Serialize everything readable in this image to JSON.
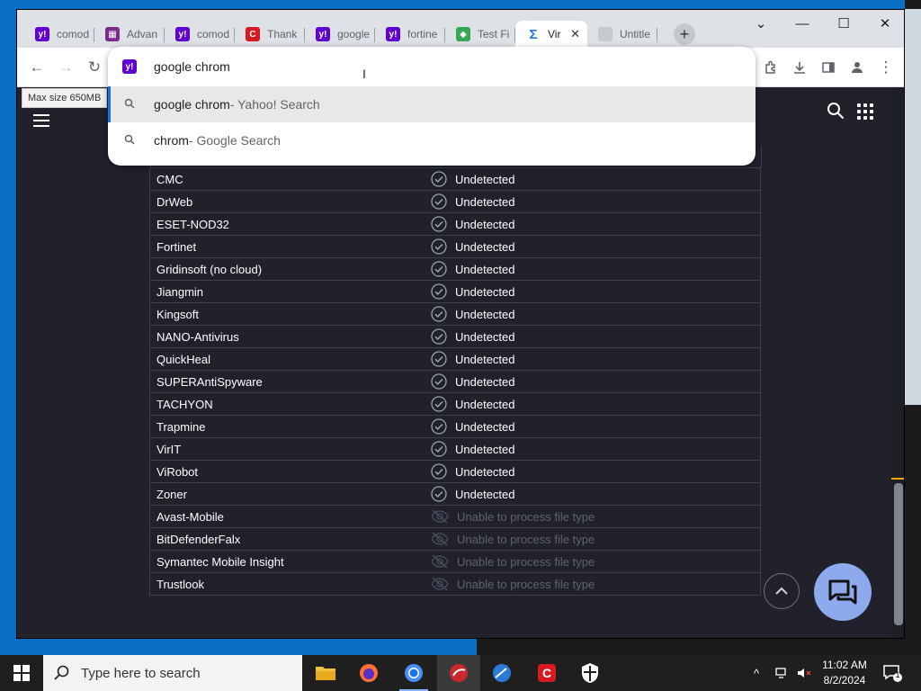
{
  "browser": {
    "tabs": [
      {
        "title": "comod",
        "favicon": "yahoo-icon",
        "color": "#6001d2",
        "glyph": "y!"
      },
      {
        "title": "Advan",
        "favicon": "grid-logo-icon",
        "color": "#7b2a8c",
        "glyph": "▦"
      },
      {
        "title": "comod",
        "favicon": "yahoo-icon",
        "color": "#6001d2",
        "glyph": "y!"
      },
      {
        "title": "Thank",
        "favicon": "comodo-c-icon",
        "color": "#d71920",
        "glyph": "C"
      },
      {
        "title": "google",
        "favicon": "yahoo-icon",
        "color": "#6001d2",
        "glyph": "y!"
      },
      {
        "title": "fortine",
        "favicon": "yahoo-icon",
        "color": "#6001d2",
        "glyph": "y!"
      },
      {
        "title": "Test Fi",
        "favicon": "shield-icon",
        "color": "#34a853",
        "glyph": "◆"
      },
      {
        "title": "Vir",
        "favicon": "virustotal-icon",
        "color": "#ffffff",
        "glyph": "Σ",
        "active": true
      },
      {
        "title": "Untitle",
        "favicon": "blank-page-icon",
        "color": "#9aa0a6",
        "glyph": ""
      }
    ],
    "omnibox": {
      "value": "google chrom",
      "suggestions": [
        {
          "main": "google chrom",
          "sub": " - Yahoo! Search",
          "selected": true
        },
        {
          "main": "chrom",
          "sub": " - Google Search",
          "selected": false
        }
      ]
    },
    "tooltip": "Max size 650MB"
  },
  "results": {
    "rows": [
      {
        "engine": "CMC",
        "status": "Undetected",
        "kind": "undetected"
      },
      {
        "engine": "DrWeb",
        "status": "Undetected",
        "kind": "undetected"
      },
      {
        "engine": "ESET-NOD32",
        "status": "Undetected",
        "kind": "undetected"
      },
      {
        "engine": "Fortinet",
        "status": "Undetected",
        "kind": "undetected"
      },
      {
        "engine": "Gridinsoft (no cloud)",
        "status": "Undetected",
        "kind": "undetected"
      },
      {
        "engine": "Jiangmin",
        "status": "Undetected",
        "kind": "undetected"
      },
      {
        "engine": "Kingsoft",
        "status": "Undetected",
        "kind": "undetected"
      },
      {
        "engine": "NANO-Antivirus",
        "status": "Undetected",
        "kind": "undetected"
      },
      {
        "engine": "QuickHeal",
        "status": "Undetected",
        "kind": "undetected"
      },
      {
        "engine": "SUPERAntiSpyware",
        "status": "Undetected",
        "kind": "undetected"
      },
      {
        "engine": "TACHYON",
        "status": "Undetected",
        "kind": "undetected"
      },
      {
        "engine": "Trapmine",
        "status": "Undetected",
        "kind": "undetected"
      },
      {
        "engine": "VirIT",
        "status": "Undetected",
        "kind": "undetected"
      },
      {
        "engine": "ViRobot",
        "status": "Undetected",
        "kind": "undetected"
      },
      {
        "engine": "Zoner",
        "status": "Undetected",
        "kind": "undetected"
      },
      {
        "engine": "Avast-Mobile",
        "status": "Unable to process file type",
        "kind": "unsupported"
      },
      {
        "engine": "BitDefenderFalx",
        "status": "Unable to process file type",
        "kind": "unsupported"
      },
      {
        "engine": "Symantec Mobile Insight",
        "status": "Unable to process file type",
        "kind": "unsupported"
      },
      {
        "engine": "Trustlook",
        "status": "Unable to process file type",
        "kind": "unsupported"
      }
    ]
  },
  "taskbar": {
    "search_placeholder": "Type here to search",
    "time": "11:02 AM",
    "date": "8/2/2024",
    "notification_count": "1"
  },
  "colors": {
    "page_bg": "#20212b",
    "accent_chat": "#8ea9ec",
    "yahoo_purple": "#6001d2"
  }
}
